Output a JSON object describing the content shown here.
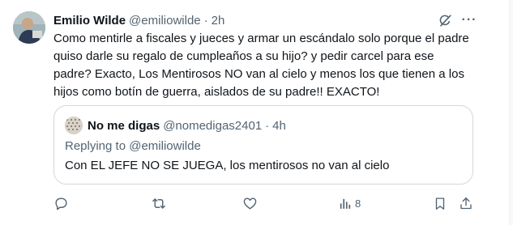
{
  "tweet": {
    "author_name": "Emilio Wilde",
    "author_handle": "@emiliowilde",
    "separator": "·",
    "time": "2h",
    "text": "Como mentirle a fiscales y jueces y armar un escándalo solo porque el padre quiso darle su regalo de cumpleaños a su hijo? y pedir carcel para ese padre? Exacto, Los Mentirosos NO van al cielo y menos los que tienen a los hijos como botín de guerra, aislados de su padre!! EXACTO!",
    "icons": {
      "grok": "grok-icon",
      "more": "more-options-icon"
    }
  },
  "quoted": {
    "author_name": "No me digas",
    "author_handle": "@nomedigas2401",
    "separator": "·",
    "time": "4h",
    "replying_to_prefix": "Replying to ",
    "replying_to_handle": "@emiliowilde",
    "text": "Con EL JEFE NO SE JUEGA, los mentirosos no van al cielo"
  },
  "actions": {
    "reply": {
      "icon": "reply-icon",
      "count": ""
    },
    "retweet": {
      "icon": "retweet-icon",
      "count": ""
    },
    "like": {
      "icon": "like-icon",
      "count": ""
    },
    "views": {
      "icon": "views-icon",
      "count": "8"
    },
    "bookmark": {
      "icon": "bookmark-icon"
    },
    "share": {
      "icon": "share-icon"
    }
  },
  "colors": {
    "text_primary": "#0f1419",
    "text_secondary": "#536471",
    "border": "#cfd9de"
  }
}
